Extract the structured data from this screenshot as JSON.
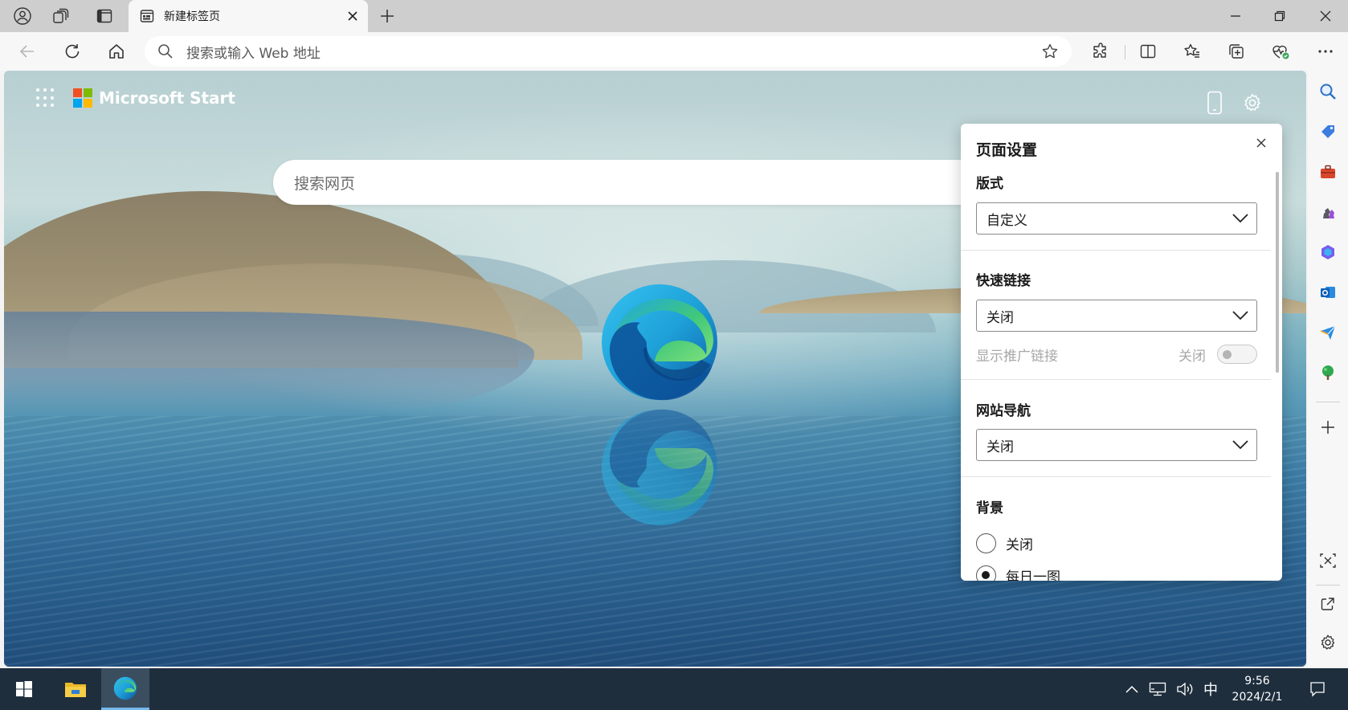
{
  "browser": {
    "tab": {
      "title": "新建标签页"
    },
    "address_bar": {
      "placeholder": "搜索或输入 Web 地址"
    }
  },
  "new_tab_page": {
    "brand": "Microsoft Start",
    "search": {
      "placeholder": "搜索网页"
    }
  },
  "settings_panel": {
    "title": "页面设置",
    "layout": {
      "label": "版式",
      "value": "自定义"
    },
    "quick_links": {
      "label": "快速链接",
      "value": "关闭",
      "promo_label": "显示推广链接",
      "promo_state": "关闭",
      "promo_enabled": false
    },
    "site_nav": {
      "label": "网站导航",
      "value": "关闭"
    },
    "background": {
      "label": "背景",
      "options": [
        {
          "label": "关闭",
          "selected": false
        },
        {
          "label": "每日一图",
          "selected": true
        }
      ]
    }
  },
  "taskbar": {
    "time": "9:56",
    "date": "2024/2/1",
    "ime": "中"
  },
  "colors": {
    "tab_strip": "#cecece",
    "toolbar": "#f7f7f7",
    "taskbar": "#1e2e3d",
    "taskbar_active_indicator": "#76b9ed",
    "ms_red": "#f25022",
    "ms_green": "#7fba00",
    "ms_blue": "#00a4ef",
    "ms_yellow": "#ffb900"
  }
}
